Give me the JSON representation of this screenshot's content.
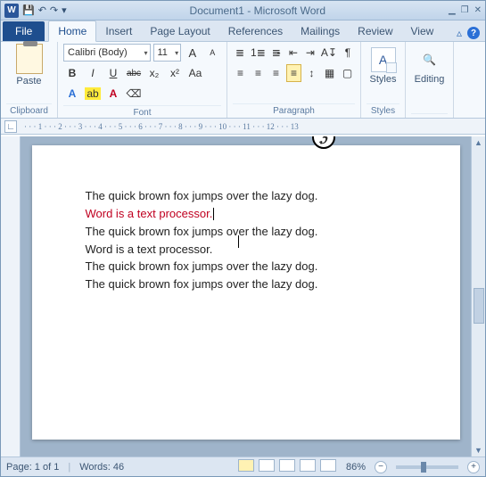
{
  "window": {
    "app_letter": "W",
    "title": "Document1  -  Microsoft Word",
    "qat": {
      "save": "💾",
      "undo": "↶",
      "redo": "↷",
      "dropdown": "▾"
    },
    "winbuttons": {
      "min": "▁",
      "restore": "❐",
      "close": "✕"
    }
  },
  "tabs": {
    "file": "File",
    "items": [
      "Home",
      "Insert",
      "Page Layout",
      "References",
      "Mailings",
      "Review",
      "View"
    ],
    "active_index": 0,
    "expand": "▵",
    "help": "?"
  },
  "ribbon": {
    "clipboard": {
      "paste": "Paste",
      "label": "Clipboard"
    },
    "font": {
      "name": "Calibri (Body)",
      "size": "11",
      "grow": "A",
      "shrink": "A",
      "case": "Aa",
      "clear": "⌫",
      "bold": "B",
      "italic": "I",
      "underline": "U",
      "strike": "abc",
      "sub": "x₂",
      "sup": "x²",
      "effects": "A",
      "highlight": "ab",
      "color": "A",
      "label": "Font"
    },
    "paragraph": {
      "bullets": "≣",
      "numbers": "1≣",
      "multilevel": "≣̵",
      "dedent": "⇤",
      "indent": "⇥",
      "sort": "A↧",
      "marks": "¶",
      "alignL": "≡",
      "alignC": "≡",
      "alignR": "≡",
      "alignJ": "≡",
      "spacing": "↕",
      "shading": "▦",
      "borders": "▢",
      "label": "Paragraph"
    },
    "styles": {
      "text": "Styles",
      "label": "Styles",
      "glyph": "A"
    },
    "editing": {
      "text": "Editing",
      "label": ""
    }
  },
  "ruler": {
    "tabchar": "∟",
    "numbers_top": "· · · 1 · · · 2 · · · 3 · · · 4 · · · 5 · · · 6 · · · 7 · · · 8 · · · 9 · · · 10 · · · 11 · · · 12 · · · 13"
  },
  "document": {
    "lines": [
      {
        "text": "The quick brown fox jumps over the lazy dog.",
        "style": "normal"
      },
      {
        "text": "Word is a text processor.",
        "style": "red",
        "caret_after": true
      },
      {
        "text": "The quick brown fox jumps over the lazy dog.",
        "style": "normal",
        "ibeam_at": 28
      },
      {
        "text": "Word is a text processor.",
        "style": "normal"
      },
      {
        "text": "The quick brown fox jumps over the lazy dog.",
        "style": "normal"
      },
      {
        "text": "The quick brown fox jumps over the lazy dog.",
        "style": "normal"
      }
    ],
    "brush_glyph": "ℨ"
  },
  "status": {
    "page": "Page: 1 of 1",
    "words": "Words: 46",
    "zoom": "86%",
    "minus": "−",
    "plus": "+"
  }
}
